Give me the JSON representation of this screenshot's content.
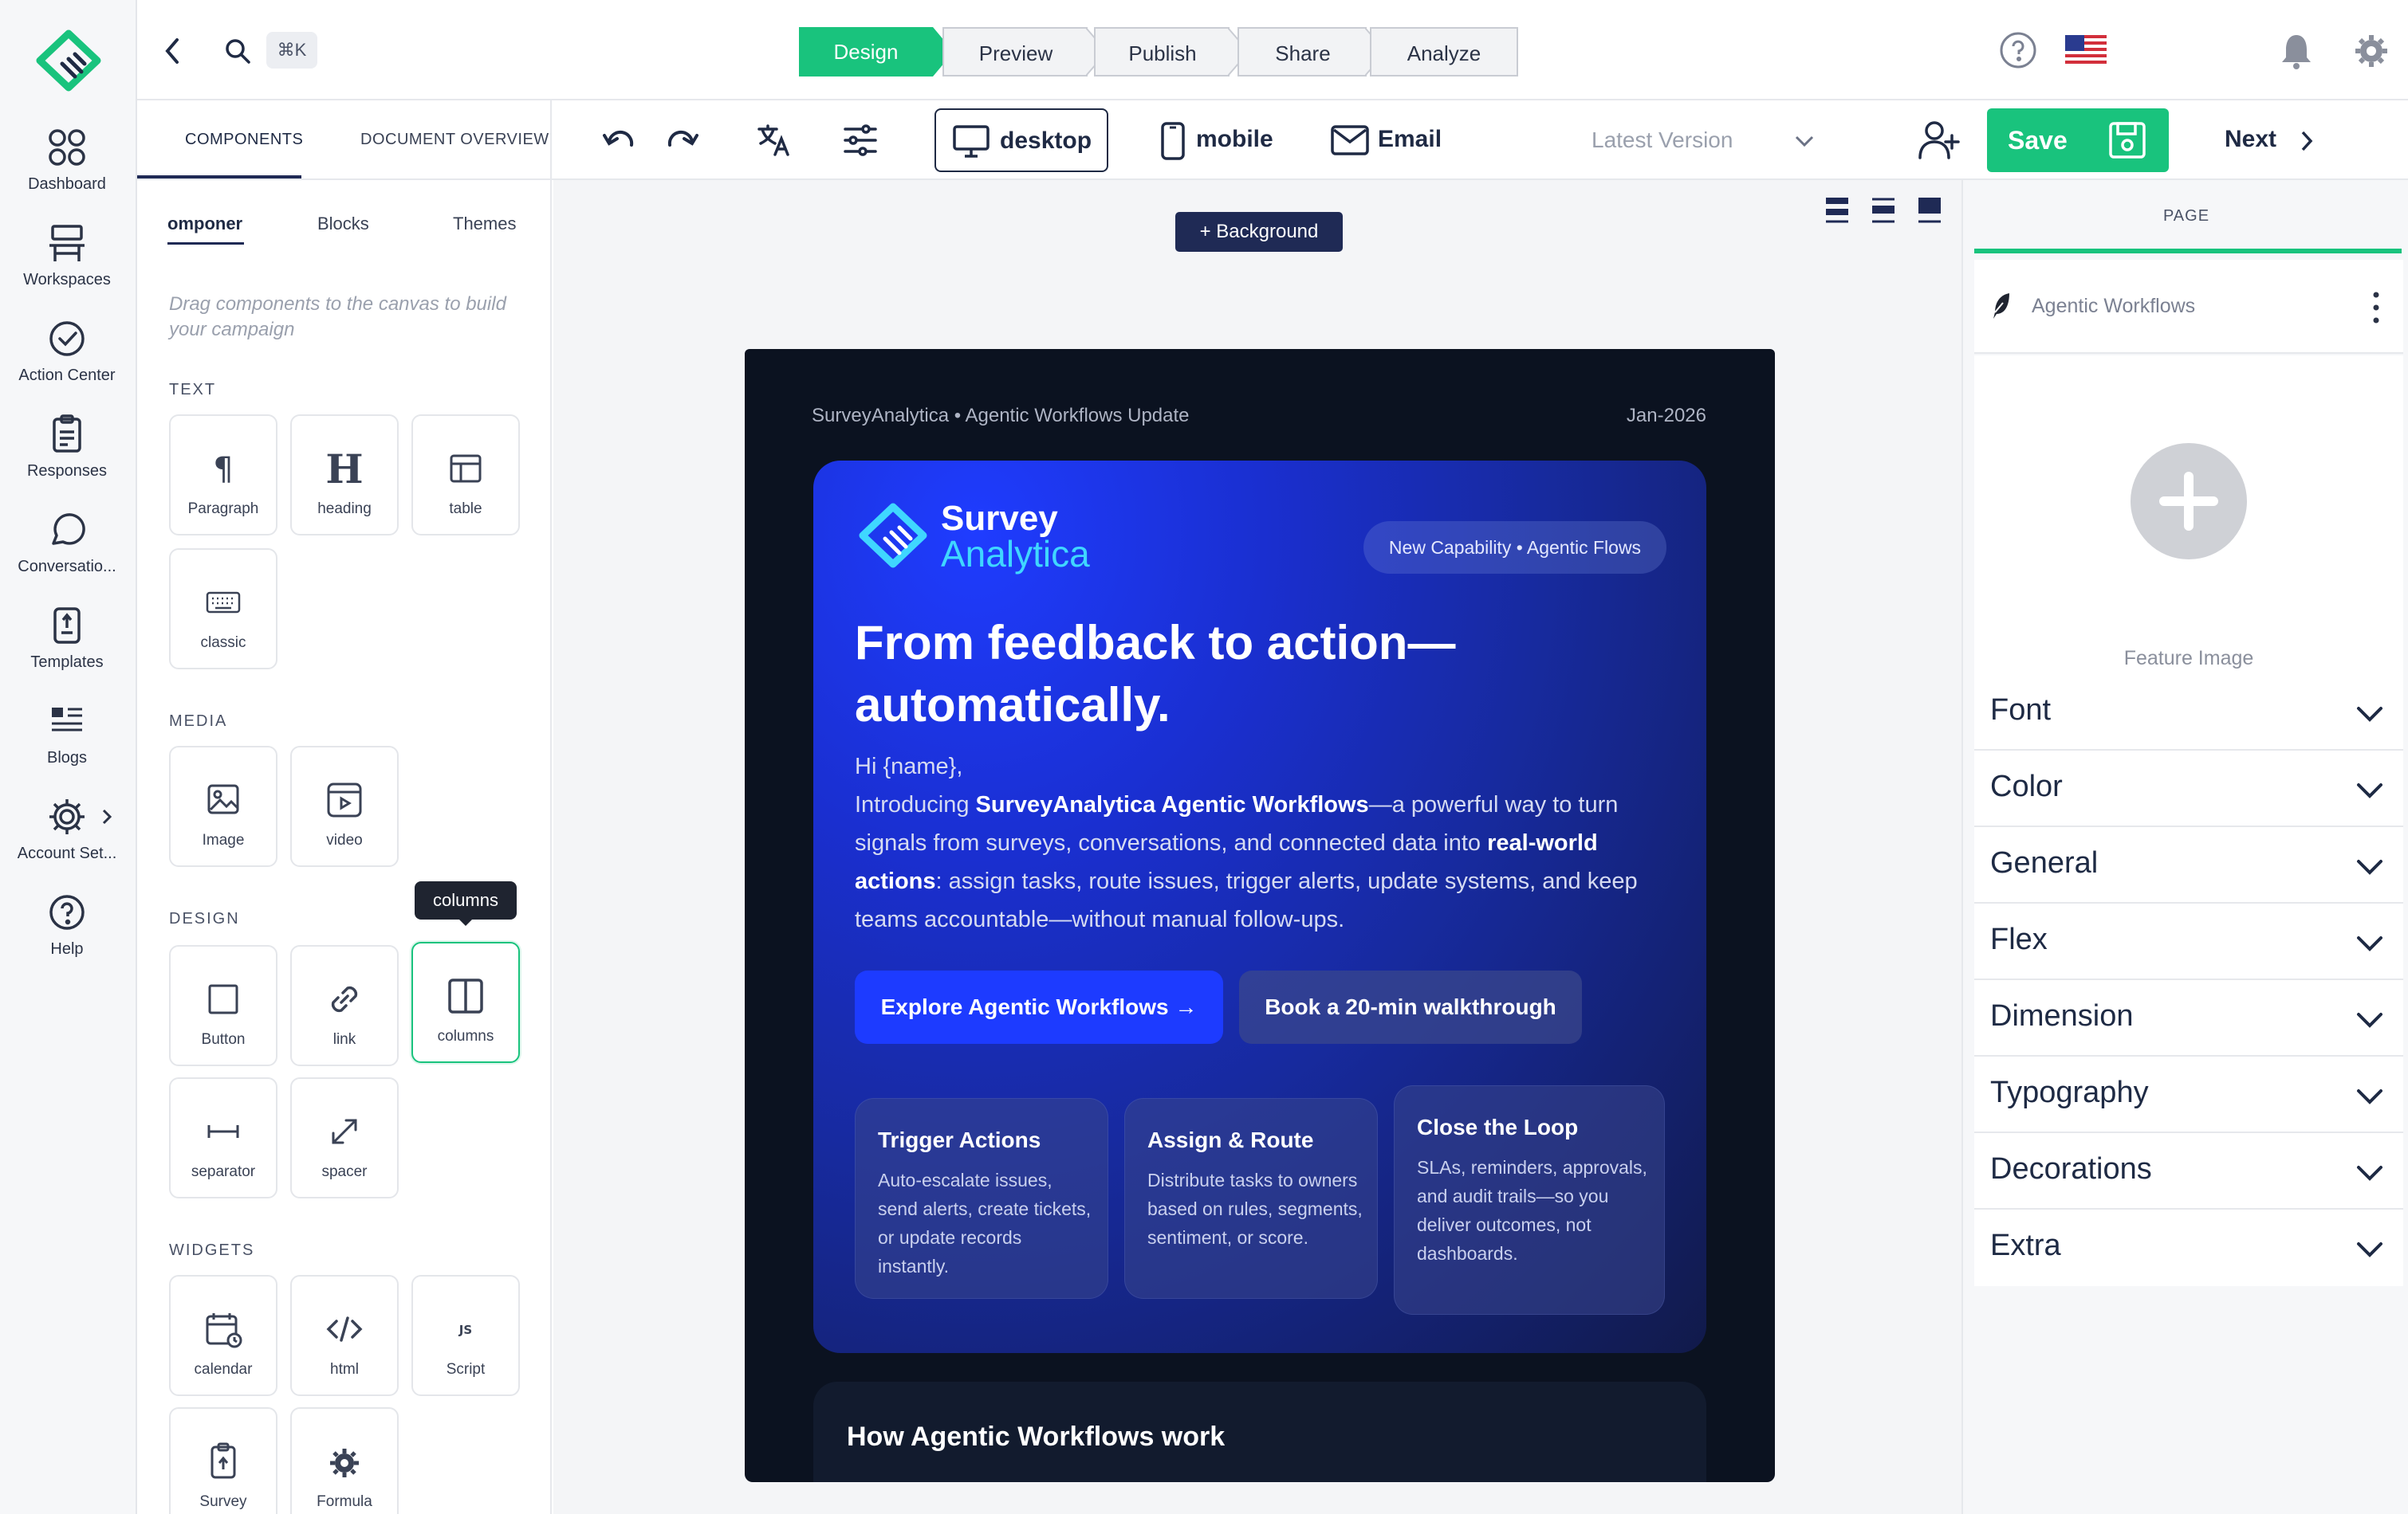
{
  "nav": {
    "items": [
      {
        "label": "Dashboard",
        "icon": "dashboard-icon"
      },
      {
        "label": "Workspaces",
        "icon": "workspaces-icon"
      },
      {
        "label": "Action Center",
        "icon": "action-center-icon"
      },
      {
        "label": "Responses",
        "icon": "responses-icon"
      },
      {
        "label": "Conversatio...",
        "icon": "conversations-icon"
      },
      {
        "label": "Templates",
        "icon": "templates-icon"
      },
      {
        "label": "Blogs",
        "icon": "blogs-icon"
      },
      {
        "label": "Account Set...",
        "icon": "account-settings-icon"
      },
      {
        "label": "Help",
        "icon": "help-icon"
      }
    ]
  },
  "topbar": {
    "search_shortcut": "⌘K",
    "steps": [
      "Design",
      "Preview",
      "Publish",
      "Share",
      "Analyze"
    ],
    "active_step": "Design"
  },
  "toolbar": {
    "panel_tabs": [
      "COMPONENTS",
      "DOCUMENT OVERVIEW"
    ],
    "devices": [
      "desktop",
      "mobile",
      "Email"
    ],
    "active_device": "desktop",
    "version": "Latest Version",
    "save": "Save",
    "next": "Next"
  },
  "components": {
    "sub_tabs": [
      "omponer",
      "Blocks",
      "Themes"
    ],
    "hint": "Drag components to the canvas to build your campaign",
    "sections": {
      "text": "TEXT",
      "media": "MEDIA",
      "design": "DESIGN",
      "widgets": "WIDGETS"
    },
    "text_items": [
      "Paragraph",
      "heading",
      "table",
      "classic"
    ],
    "media_items": [
      "Image",
      "video"
    ],
    "design_items": [
      "Button",
      "link",
      "columns",
      "separator",
      "spacer"
    ],
    "widget_items": [
      "calendar",
      "html",
      "Script",
      "Survey",
      "Formula"
    ],
    "tooltip": "columns"
  },
  "canvas": {
    "background_button": "+ Background"
  },
  "email": {
    "preheader_left": "SurveyAnalytica • Agentic Workflows Update",
    "preheader_right": "Jan-2026",
    "brand_line1": "Survey",
    "brand_line2": "Analytica",
    "pill": "New Capability • Agentic Flows",
    "headline_line1": "From feedback to action—",
    "headline_line2": "automatically.",
    "greeting": "Hi {name},",
    "intro_prefix": "Introducing ",
    "intro_bold": "SurveyAnalytica Agentic Workflows",
    "intro_mid": "—a powerful way to turn signals from surveys, conversations, and connected data into ",
    "intro_bold2": "real-world actions",
    "intro_end": ": assign tasks, route issues, trigger alerts, update systems, and keep teams accountable—without manual follow-ups.",
    "cta_primary": "Explore Agentic Workflows →",
    "cta_secondary": "Book a 20-min walkthrough",
    "features": [
      {
        "title": "Trigger Actions",
        "body": "Auto-escalate issues, send alerts, create tickets, or update records instantly."
      },
      {
        "title": "Assign & Route",
        "body": "Distribute tasks to owners based on rules, segments, sentiment, or score."
      },
      {
        "title": "Close the Loop",
        "body": "SLAs, reminders, approvals, and audit trails—so you deliver outcomes, not dashboards."
      }
    ],
    "section2_title": "How Agentic Workflows work"
  },
  "rightpanel": {
    "tab": "PAGE",
    "page_name": "Agentic Workflows",
    "feature_image": "Feature Image",
    "accordions": [
      "Font",
      "Color",
      "General",
      "Flex",
      "Dimension",
      "Typography",
      "Decorations",
      "Extra"
    ]
  },
  "colors": {
    "brand_green": "#19c37d",
    "navy": "#1f2a55",
    "email_bg": "#0b1220",
    "cta_blue": "#1d3bff"
  }
}
